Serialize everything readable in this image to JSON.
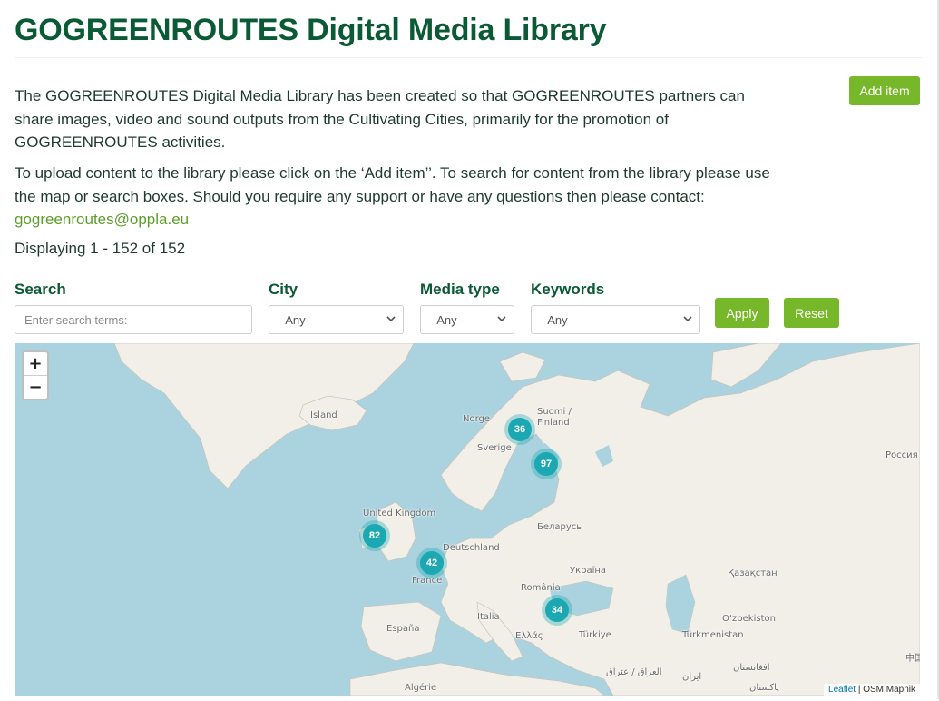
{
  "header": {
    "title": "GOGREENROUTES Digital Media Library"
  },
  "actions": {
    "add_item": "Add item"
  },
  "intro": {
    "p1": "The GOGREENROUTES Digital Media Library has been created so that GOGREENROUTES partners can share images, video and sound outputs from the Cultivating Cities, primarily for the promotion of GOGREENROUTES activities.",
    "p2": "To upload content to the library please click on the ‘Add item’’. To search for content from the library please use the map or search boxes. Should you require any support or have any questions then please contact:",
    "email": "gogreenroutes@oppla.eu"
  },
  "results": {
    "count_text": "Displaying 1 - 152 of 152"
  },
  "filters": {
    "search_label": "Search",
    "search_placeholder": "Enter search terms:",
    "city_label": "City",
    "city_value": "- Any -",
    "media_label": "Media type",
    "media_value": "- Any -",
    "keywords_label": "Keywords",
    "keywords_value": "- Any -",
    "apply": "Apply",
    "reset": "Reset"
  },
  "map": {
    "zoom_in": "+",
    "zoom_out": "−",
    "clusters": [
      "36",
      "97",
      "82",
      "42",
      "34"
    ],
    "places": {
      "island": "Ísland",
      "norge": "Norge",
      "suomi": "Suomi /",
      "finland": "Finland",
      "sverige": "Sverige",
      "uk": "United Kingdom",
      "belarus": "Беларусь",
      "deutschland": "Deutschland",
      "ukraina": "Україна",
      "france": "France",
      "romania": "România",
      "kazakhstan": "Қазақстан",
      "russia": "Россия",
      "italia": "Italia",
      "espana": "España",
      "ellas": "Ελλάς",
      "turkiye": "Türkiye",
      "ozbekiston": "O‘zbekiston",
      "turkmenistan": "Türkmenistan",
      "afghanistan": "افغانستان",
      "iraq": "العراق / عێراق",
      "iran": "ایران",
      "pakistan": "پاکستان",
      "algerie": "Algérie",
      "china": "中国"
    },
    "attribution_leaflet": "Leaflet",
    "attribution_rest": " | OSM Mapnik"
  },
  "colors": {
    "title_green": "#0b5a36",
    "button_green": "#77b82a",
    "cluster_teal": "#1ba8b2",
    "sea": "#aad3df",
    "land": "#f2efe9"
  }
}
